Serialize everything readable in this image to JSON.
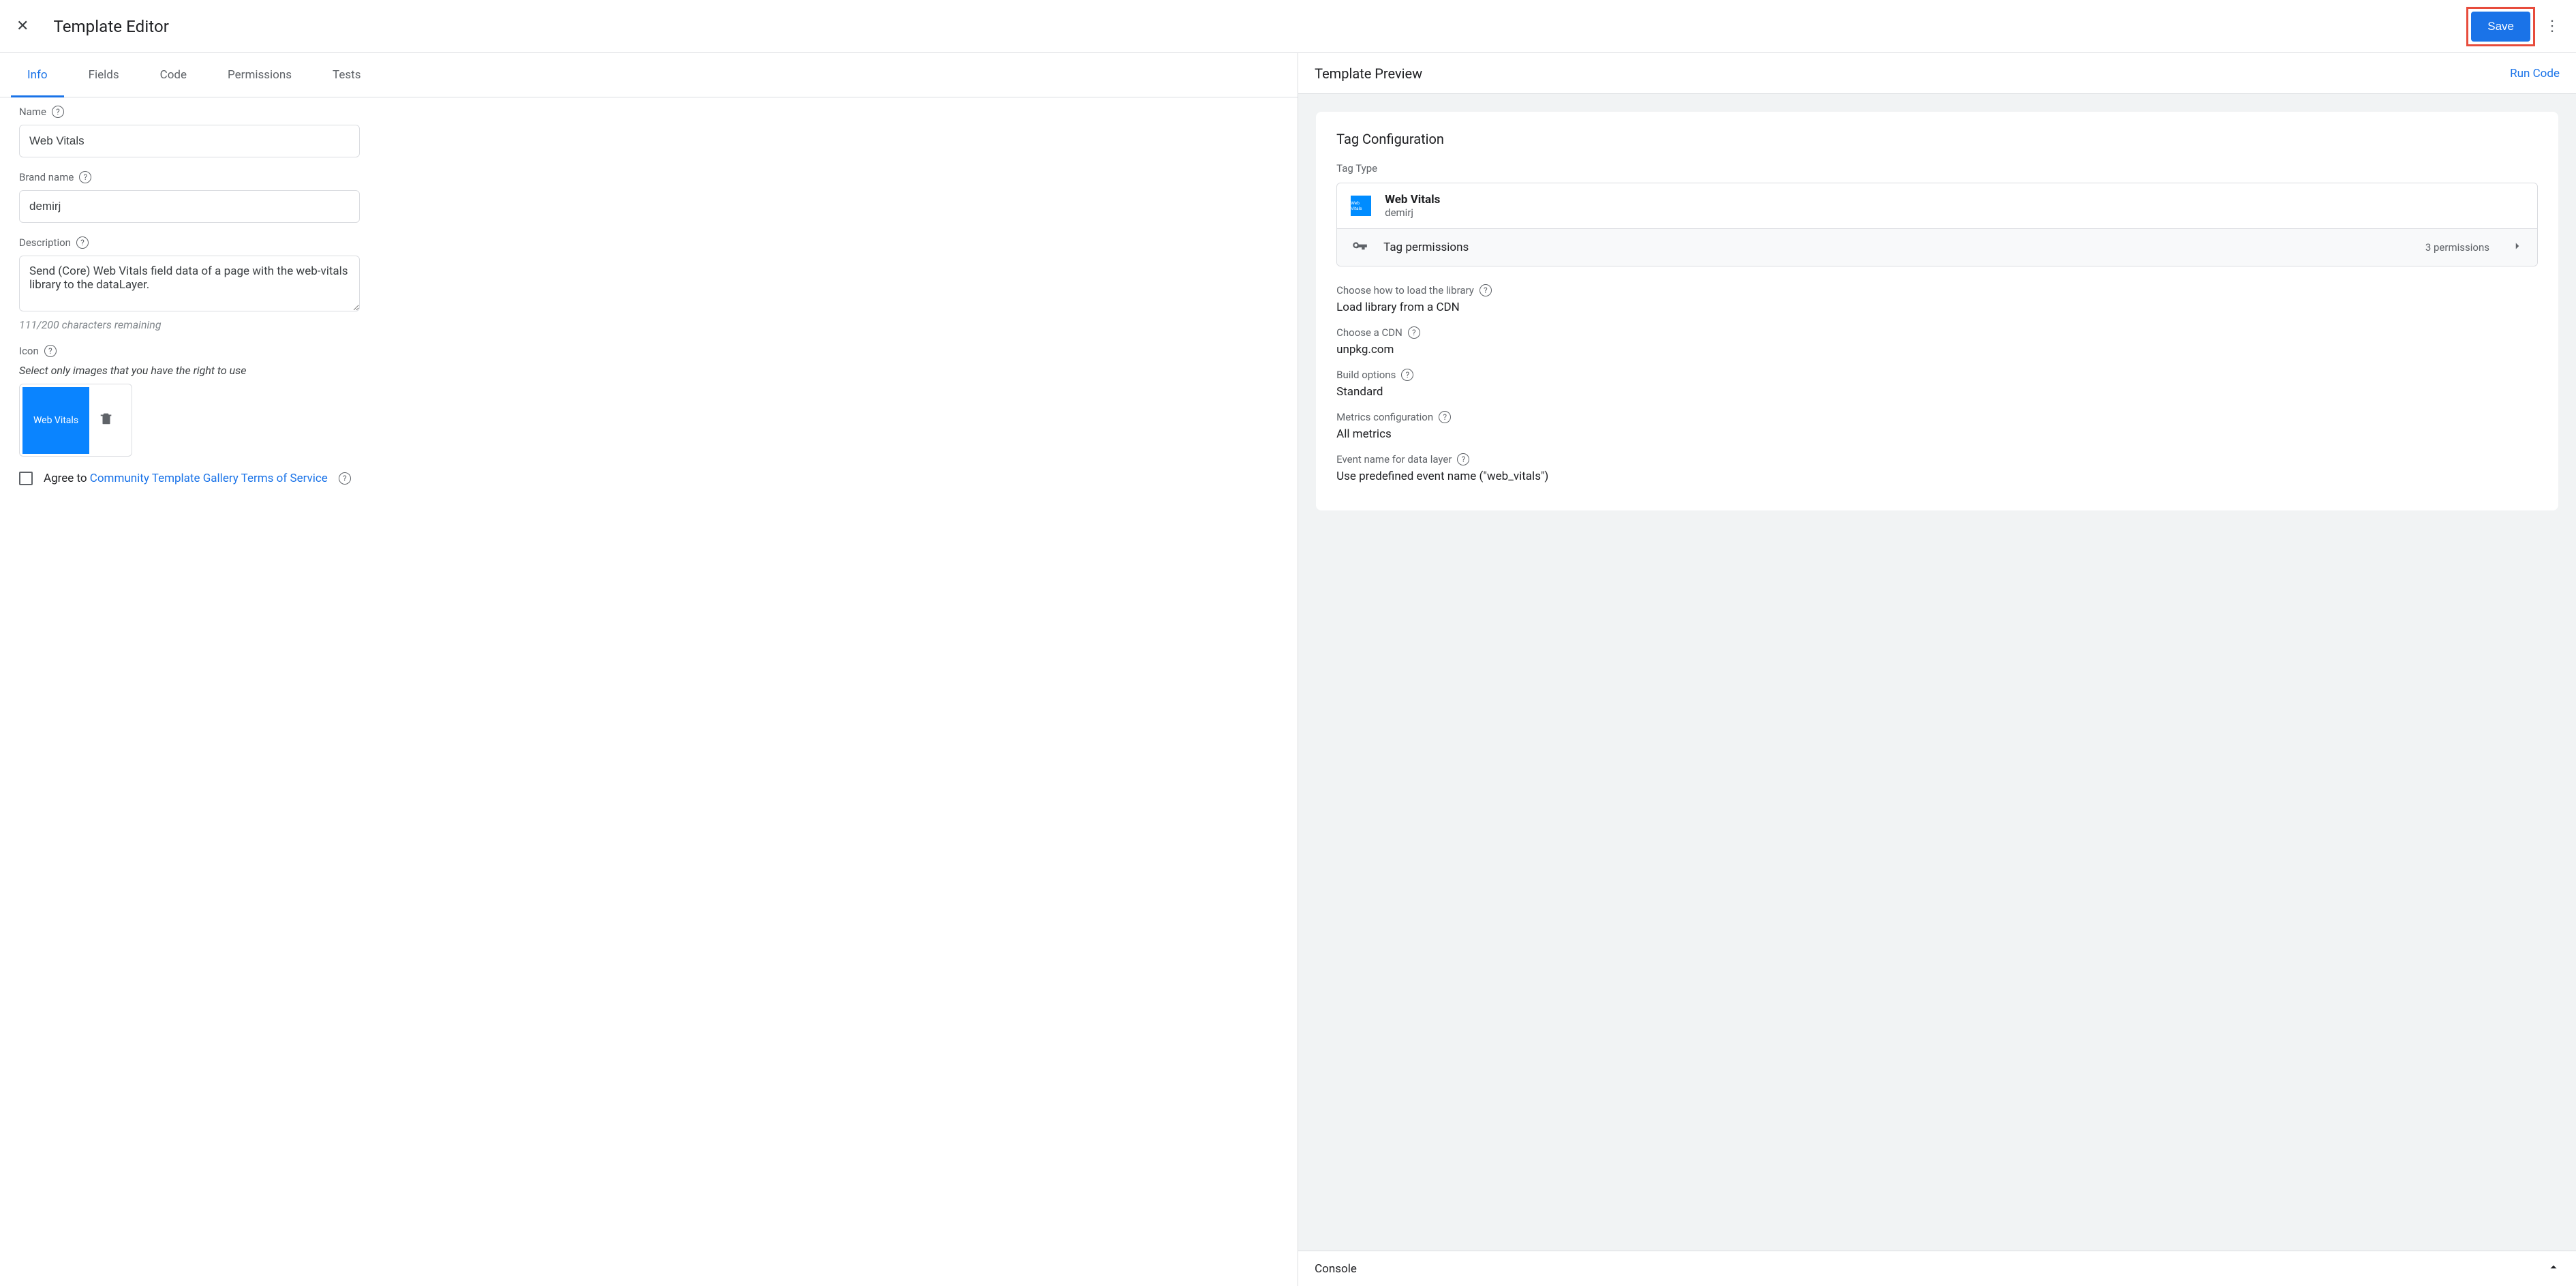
{
  "header": {
    "title": "Template Editor",
    "save_label": "Save"
  },
  "tabs": [
    "Info",
    "Fields",
    "Code",
    "Permissions",
    "Tests"
  ],
  "active_tab": 0,
  "form": {
    "name_label": "Name",
    "name_value": "Web Vitals",
    "brand_label": "Brand name",
    "brand_value": "demirj",
    "desc_label": "Description",
    "desc_value": "Send (Core) Web Vitals field data of a page with the web-vitals library to the dataLayer.",
    "desc_counter": "111/200 characters remaining",
    "icon_label": "Icon",
    "icon_note": "Select only images that you have the right to use",
    "icon_square_text": "Web Vitals",
    "agree_prefix": "Agree to ",
    "agree_link": "Community Template Gallery Terms of Service"
  },
  "preview": {
    "title": "Template Preview",
    "run_code": "Run Code",
    "card_title": "Tag Configuration",
    "tag_type_label": "Tag Type",
    "tag_name": "Web Vitals",
    "tag_sub": "demirj",
    "tag_perm_label": "Tag permissions",
    "tag_perm_count": "3 permissions",
    "configs": [
      {
        "label": "Choose how to load the library",
        "value": "Load library from a CDN",
        "help": true
      },
      {
        "label": "Choose a CDN",
        "value": "unpkg.com",
        "help": true
      },
      {
        "label": "Build options",
        "value": "Standard",
        "help": true
      },
      {
        "label": "Metrics configuration",
        "value": "All metrics",
        "help": true
      },
      {
        "label": "Event name for data layer",
        "value": "Use predefined event name (\"web_vitals\")",
        "help": true
      }
    ]
  },
  "console": {
    "title": "Console"
  }
}
